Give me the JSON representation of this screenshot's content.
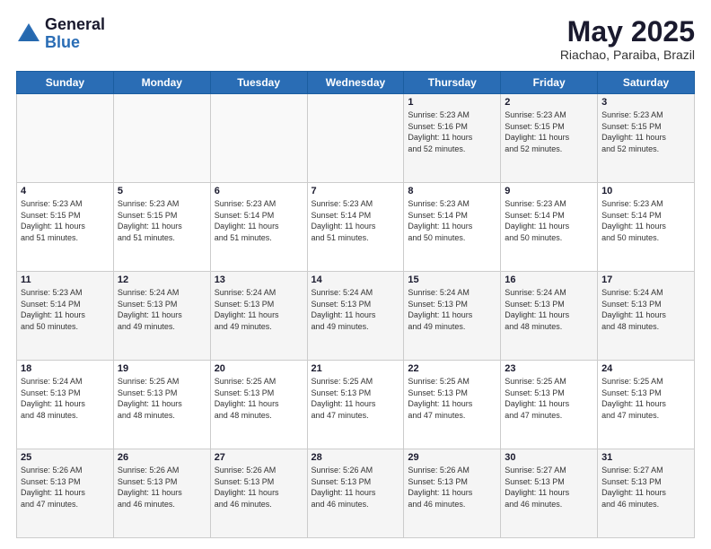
{
  "logo": {
    "general": "General",
    "blue": "Blue"
  },
  "header": {
    "month": "May 2025",
    "location": "Riachao, Paraiba, Brazil"
  },
  "weekdays": [
    "Sunday",
    "Monday",
    "Tuesday",
    "Wednesday",
    "Thursday",
    "Friday",
    "Saturday"
  ],
  "weeks": [
    [
      {
        "day": "",
        "info": ""
      },
      {
        "day": "",
        "info": ""
      },
      {
        "day": "",
        "info": ""
      },
      {
        "day": "",
        "info": ""
      },
      {
        "day": "1",
        "info": "Sunrise: 5:23 AM\nSunset: 5:16 PM\nDaylight: 11 hours\nand 52 minutes."
      },
      {
        "day": "2",
        "info": "Sunrise: 5:23 AM\nSunset: 5:15 PM\nDaylight: 11 hours\nand 52 minutes."
      },
      {
        "day": "3",
        "info": "Sunrise: 5:23 AM\nSunset: 5:15 PM\nDaylight: 11 hours\nand 52 minutes."
      }
    ],
    [
      {
        "day": "4",
        "info": "Sunrise: 5:23 AM\nSunset: 5:15 PM\nDaylight: 11 hours\nand 51 minutes."
      },
      {
        "day": "5",
        "info": "Sunrise: 5:23 AM\nSunset: 5:15 PM\nDaylight: 11 hours\nand 51 minutes."
      },
      {
        "day": "6",
        "info": "Sunrise: 5:23 AM\nSunset: 5:14 PM\nDaylight: 11 hours\nand 51 minutes."
      },
      {
        "day": "7",
        "info": "Sunrise: 5:23 AM\nSunset: 5:14 PM\nDaylight: 11 hours\nand 51 minutes."
      },
      {
        "day": "8",
        "info": "Sunrise: 5:23 AM\nSunset: 5:14 PM\nDaylight: 11 hours\nand 50 minutes."
      },
      {
        "day": "9",
        "info": "Sunrise: 5:23 AM\nSunset: 5:14 PM\nDaylight: 11 hours\nand 50 minutes."
      },
      {
        "day": "10",
        "info": "Sunrise: 5:23 AM\nSunset: 5:14 PM\nDaylight: 11 hours\nand 50 minutes."
      }
    ],
    [
      {
        "day": "11",
        "info": "Sunrise: 5:23 AM\nSunset: 5:14 PM\nDaylight: 11 hours\nand 50 minutes."
      },
      {
        "day": "12",
        "info": "Sunrise: 5:24 AM\nSunset: 5:13 PM\nDaylight: 11 hours\nand 49 minutes."
      },
      {
        "day": "13",
        "info": "Sunrise: 5:24 AM\nSunset: 5:13 PM\nDaylight: 11 hours\nand 49 minutes."
      },
      {
        "day": "14",
        "info": "Sunrise: 5:24 AM\nSunset: 5:13 PM\nDaylight: 11 hours\nand 49 minutes."
      },
      {
        "day": "15",
        "info": "Sunrise: 5:24 AM\nSunset: 5:13 PM\nDaylight: 11 hours\nand 49 minutes."
      },
      {
        "day": "16",
        "info": "Sunrise: 5:24 AM\nSunset: 5:13 PM\nDaylight: 11 hours\nand 48 minutes."
      },
      {
        "day": "17",
        "info": "Sunrise: 5:24 AM\nSunset: 5:13 PM\nDaylight: 11 hours\nand 48 minutes."
      }
    ],
    [
      {
        "day": "18",
        "info": "Sunrise: 5:24 AM\nSunset: 5:13 PM\nDaylight: 11 hours\nand 48 minutes."
      },
      {
        "day": "19",
        "info": "Sunrise: 5:25 AM\nSunset: 5:13 PM\nDaylight: 11 hours\nand 48 minutes."
      },
      {
        "day": "20",
        "info": "Sunrise: 5:25 AM\nSunset: 5:13 PM\nDaylight: 11 hours\nand 48 minutes."
      },
      {
        "day": "21",
        "info": "Sunrise: 5:25 AM\nSunset: 5:13 PM\nDaylight: 11 hours\nand 47 minutes."
      },
      {
        "day": "22",
        "info": "Sunrise: 5:25 AM\nSunset: 5:13 PM\nDaylight: 11 hours\nand 47 minutes."
      },
      {
        "day": "23",
        "info": "Sunrise: 5:25 AM\nSunset: 5:13 PM\nDaylight: 11 hours\nand 47 minutes."
      },
      {
        "day": "24",
        "info": "Sunrise: 5:25 AM\nSunset: 5:13 PM\nDaylight: 11 hours\nand 47 minutes."
      }
    ],
    [
      {
        "day": "25",
        "info": "Sunrise: 5:26 AM\nSunset: 5:13 PM\nDaylight: 11 hours\nand 47 minutes."
      },
      {
        "day": "26",
        "info": "Sunrise: 5:26 AM\nSunset: 5:13 PM\nDaylight: 11 hours\nand 46 minutes."
      },
      {
        "day": "27",
        "info": "Sunrise: 5:26 AM\nSunset: 5:13 PM\nDaylight: 11 hours\nand 46 minutes."
      },
      {
        "day": "28",
        "info": "Sunrise: 5:26 AM\nSunset: 5:13 PM\nDaylight: 11 hours\nand 46 minutes."
      },
      {
        "day": "29",
        "info": "Sunrise: 5:26 AM\nSunset: 5:13 PM\nDaylight: 11 hours\nand 46 minutes."
      },
      {
        "day": "30",
        "info": "Sunrise: 5:27 AM\nSunset: 5:13 PM\nDaylight: 11 hours\nand 46 minutes."
      },
      {
        "day": "31",
        "info": "Sunrise: 5:27 AM\nSunset: 5:13 PM\nDaylight: 11 hours\nand 46 minutes."
      }
    ]
  ]
}
